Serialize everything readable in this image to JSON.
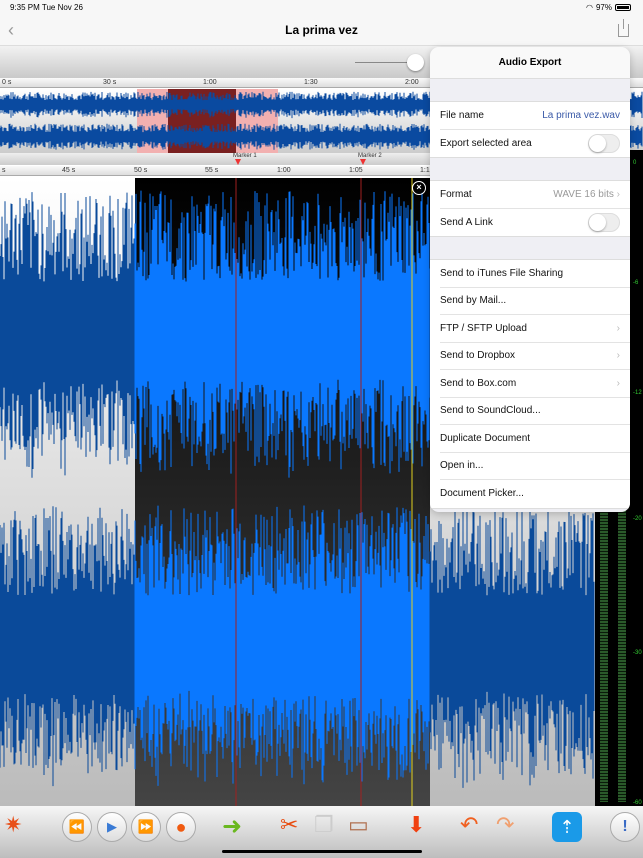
{
  "status": {
    "time": "9:35 PM  Tue Nov 26",
    "battery": "97%"
  },
  "nav": {
    "title": "La prima vez",
    "back_icon": "‹"
  },
  "overview_ruler": [
    "0 s",
    "30 s",
    "1:00",
    "1:30",
    "2:00"
  ],
  "markers": [
    "Marker 1",
    "Marker 2"
  ],
  "detail_ruler": [
    "s",
    "45 s",
    "50 s",
    "55 s",
    "1:00",
    "1:05",
    "1:1"
  ],
  "meter_labels": [
    "0",
    "-6",
    "-12",
    "-20",
    "-30",
    "-60"
  ],
  "popover": {
    "title": "Audio Export",
    "file_name_label": "File name",
    "file_name_value": "La prima vez.wav",
    "export_selected_label": "Export selected area",
    "export_selected_on": false,
    "format_label": "Format",
    "format_value": "WAVE 16 bits",
    "send_link_label": "Send A Link",
    "send_link_on": false,
    "actions": [
      {
        "label": "Send to iTunes File Sharing",
        "chevron": false
      },
      {
        "label": "Send by Mail...",
        "chevron": false
      },
      {
        "label": "FTP / SFTP Upload",
        "chevron": true
      },
      {
        "label": "Send to Dropbox",
        "chevron": true
      },
      {
        "label": "Send to Box.com",
        "chevron": true
      },
      {
        "label": "Send to SoundCloud...",
        "chevron": false
      },
      {
        "label": "Duplicate Document",
        "chevron": false
      },
      {
        "label": "Open in...",
        "chevron": false
      },
      {
        "label": "Document Picker...",
        "chevron": false
      }
    ]
  },
  "colors": {
    "wave_dark": "#0a4a9a",
    "wave_selected": "#0a78ff",
    "marker": "#e33333",
    "meter_text": "#33cc33"
  }
}
